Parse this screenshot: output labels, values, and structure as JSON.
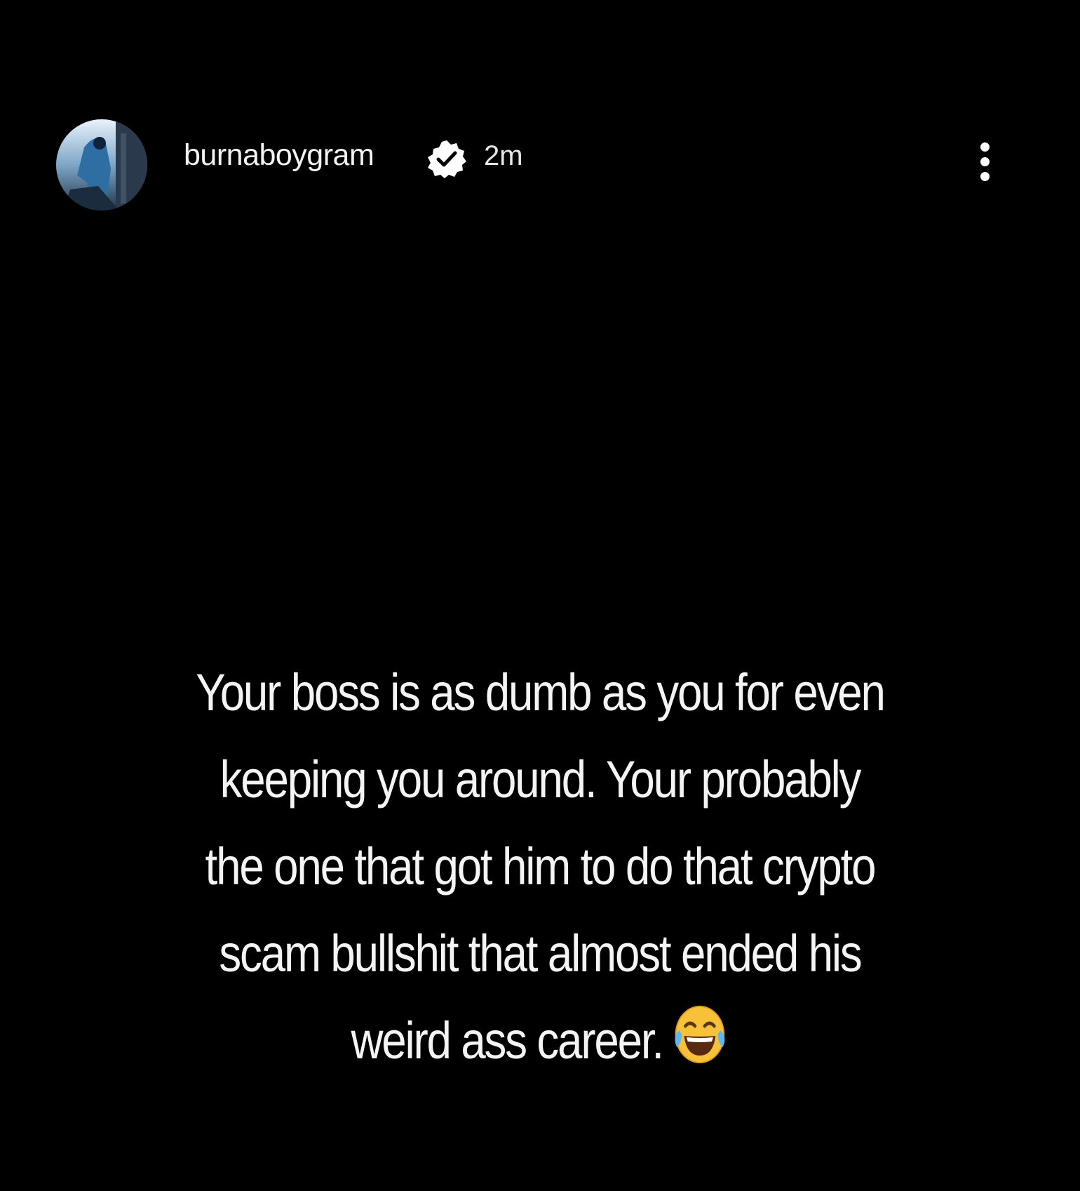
{
  "post": {
    "username": "burnaboygram",
    "verified": true,
    "time_ago": "2m",
    "caption_lines": [
      "Your boss is as dumb as you for even",
      "keeping you around. Your probably",
      "the one that got him to do that crypto",
      "scam bullshit that almost ended his",
      "weird ass career."
    ],
    "caption_emoji": "face-with-tears-of-joy"
  },
  "colors": {
    "background": "#000000",
    "text": "#ffffff",
    "emoji_face": "#f7c23a"
  },
  "icons": {
    "verified": "verified-badge-icon",
    "more": "more-options-icon"
  }
}
